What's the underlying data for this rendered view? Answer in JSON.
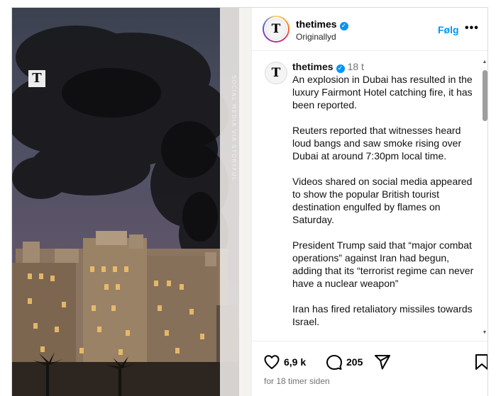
{
  "media": {
    "logo_letter": "T",
    "credit": "SOCIAL MEDIA VIA STORYFUL"
  },
  "header": {
    "username": "thetimes",
    "audio": "Originallyd",
    "follow_label": "Følg",
    "more_label": "•••",
    "avatar_letter": "T"
  },
  "caption": {
    "username": "thetimes",
    "time": "18 t",
    "avatar_letter": "T",
    "paragraphs": [
      "An explosion in Dubai has resulted in the luxury Fairmont Hotel catching fire, it has been reported.",
      "Reuters reported that witnesses heard loud bangs and saw smoke rising over Dubai at around 7:30pm local time.",
      "Videos shared on social media appeared to show the popular British tourist destination engulfed by flames on Saturday.",
      "President Trump said that “major combat operations” against Iran had begun, adding that its “terrorist regime can never have a nuclear weapon”",
      "Iran has fired retaliatory missiles towards Israel."
    ]
  },
  "actions": {
    "likes": "6,9 k",
    "comments": "205",
    "time_ago": "for 18 timer siden"
  },
  "colors": {
    "accent": "#0095f6",
    "muted": "#737373",
    "border": "#efefef"
  },
  "icons": [
    "heart-icon",
    "comment-icon",
    "share-icon",
    "bookmark-icon",
    "verified-icon"
  ]
}
